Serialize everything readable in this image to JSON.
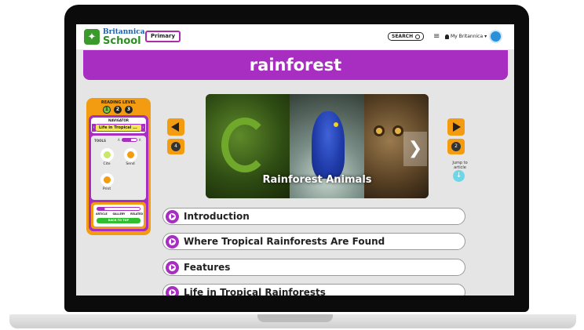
{
  "header": {
    "logo_top": "Britannica",
    "logo_bottom": "School",
    "level_badge": "Primary",
    "search_label": "SEARCH",
    "menu_glyph": "≡",
    "account_label": "My Britannica ▾"
  },
  "page_title": "rainforest",
  "tool_panel": {
    "reading_level_title": "READING LEVEL",
    "reading_levels": [
      "1",
      "2",
      "3"
    ],
    "navigator_label": "NAVIGATOR",
    "navigator_value": "Life in Tropical ...",
    "tools_label": "TOOLS",
    "text_size_small": "A",
    "text_size_large": "A",
    "tools": [
      {
        "label": "Cite",
        "icon": "cite-icon"
      },
      {
        "label": "Send",
        "icon": "send-icon"
      },
      {
        "label": "Print",
        "icon": "print-icon"
      }
    ],
    "views": [
      "ARTICLE",
      "GALLERY",
      "RELATED"
    ],
    "back_to_top": "BACK TO TOP"
  },
  "carousel": {
    "caption": "Rainforest Animals",
    "next_glyph": "❯"
  },
  "pager": {
    "prev_count": "4",
    "next_count": "2",
    "jump_text": "Jump to article"
  },
  "sections": [
    {
      "label": "Introduction"
    },
    {
      "label": "Where Tropical Rainforests Are Found"
    },
    {
      "label": "Features"
    },
    {
      "label": "Life in Tropical Rainforests"
    }
  ],
  "colors": {
    "brand_purple": "#a72ec0",
    "accent_orange": "#f39c12",
    "logo_green": "#2d8f22",
    "logo_blue": "#1e5fa8"
  }
}
